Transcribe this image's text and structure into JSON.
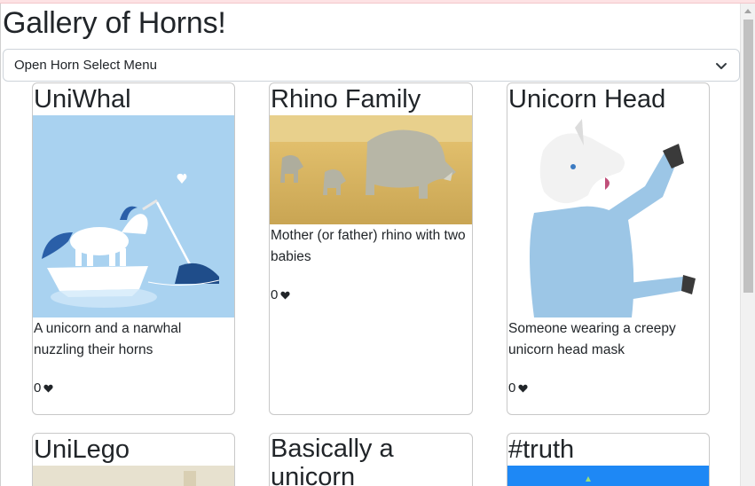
{
  "page": {
    "title": "Gallery of Horns!",
    "select_label": "Open Horn Select Menu"
  },
  "cards": [
    {
      "title": "UniWhal",
      "description": "A unicorn and a narwhal nuzzling their horns",
      "likes": "0"
    },
    {
      "title": "Rhino Family",
      "description": "Mother (or father) rhino with two babies",
      "likes": "0"
    },
    {
      "title": "Unicorn Head",
      "description": "Someone wearing a creepy unicorn head mask",
      "likes": "0"
    },
    {
      "title": "UniLego"
    },
    {
      "title": "Basically a unicorn"
    },
    {
      "title": "#truth"
    }
  ],
  "icons": {
    "like": "heart-icon",
    "select": "chevron-down-icon"
  },
  "colors": {
    "card_border": "#c8c8c8",
    "uniwhal_bg": "#a9d2f0",
    "truth_bg": "#1e88f5"
  }
}
